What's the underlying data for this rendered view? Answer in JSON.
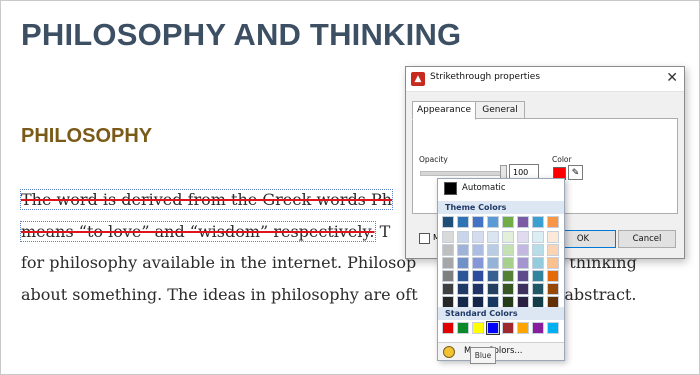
{
  "document": {
    "heading": "PHILOSOPHY AND THINKING",
    "subheading": "PHILOSOPHY",
    "line1": "The word is derived from the Greek words Ph",
    "line2_struck": "means “to love” and “wisdom” respectively.",
    "line2_rest": " T",
    "line3": "for philosophy available in the internet. Philosop",
    "line3_tail": "for thinking",
    "line4": "about something. The ideas in philosophy are oft",
    "line4_tail": "d abstract."
  },
  "dialog": {
    "title": "Strikethrough properties",
    "close_glyph": "✕",
    "tabs": [
      "Appearance",
      "General"
    ],
    "opacity_label": "Opacity",
    "opacity_value": "100",
    "color_label": "Color",
    "color_value": "#ff0000",
    "checkbox_label_visible": "M",
    "ok_label": "OK",
    "cancel_label": "Cancel"
  },
  "color_picker": {
    "automatic_label": "Automatic",
    "theme_colors_label": "Theme Colors",
    "standard_colors_label": "Standard Colors",
    "more_colors_label": "More Colors...",
    "tooltip": "Blue",
    "theme_colors": [
      [
        "#ffffff",
        "#000000",
        "#44546a",
        "#4472c4",
        "#ed7d31",
        "#a5a5a5",
        "#ffc000",
        "#5b9bd5",
        "#70ad47",
        "#7f6084"
      ],
      [
        "#f2f2f2",
        "#7f7f7f",
        "#d6dce5",
        "#d9e2f3",
        "#fbe5d6",
        "#ededed",
        "#fff2cc",
        "#deebf7",
        "#e2f0d9",
        "#e4dfec"
      ],
      [
        "#d9d9d9",
        "#595959",
        "#adb9ca",
        "#b4c7e7",
        "#f8cbad",
        "#dbdbdb",
        "#ffe699",
        "#bdd7ee",
        "#c5e0b4",
        "#ccc0da"
      ],
      [
        "#bfbfbf",
        "#404040",
        "#8497b0",
        "#8faadc",
        "#f4b183",
        "#c9c9c9",
        "#ffd966",
        "#9dc3e6",
        "#a9d18e",
        "#b2a2c7"
      ],
      [
        "#a6a6a6",
        "#262626",
        "#333f50",
        "#2f5597",
        "#c55a11",
        "#7b7b7b",
        "#bf9000",
        "#2e75b6",
        "#548235",
        "#5f497a"
      ],
      [
        "#7f7f7f",
        "#0d0d0d",
        "#222a35",
        "#1f3864",
        "#843c0c",
        "#525252",
        "#7f6000",
        "#1f4e79",
        "#385723",
        "#3f3151"
      ]
    ],
    "theme_colors_shown": [
      [
        "#1f4e79",
        "#2e74b5",
        "#4472c4",
        "#5b9bd5",
        "#70ad47",
        "#7b5aa6",
        "#3c9fd1",
        "#f79646"
      ],
      [
        "#d9d9d9",
        "#c9d5e8",
        "#d6dcf0",
        "#dbe5f1",
        "#e2efd9",
        "#e1dbef",
        "#daeef3",
        "#fde9d9"
      ],
      [
        "#bfbfbf",
        "#9eb3d7",
        "#adbce3",
        "#b8cce4",
        "#c5e0b3",
        "#c3b8df",
        "#b6dde8",
        "#fbd4b4"
      ],
      [
        "#a6a6a6",
        "#7090c8",
        "#8597d6",
        "#95b3d7",
        "#a8d08d",
        "#a595cf",
        "#93cddd",
        "#fac090"
      ],
      [
        "#7f7f7f",
        "#2b5697",
        "#2f4b9e",
        "#366092",
        "#548235",
        "#5f4a8c",
        "#31849b",
        "#e36c09"
      ],
      [
        "#404040",
        "#1f3a66",
        "#203467",
        "#244061",
        "#385723",
        "#3f315e",
        "#215867",
        "#974806"
      ],
      [
        "#262626",
        "#152a4a",
        "#16254a",
        "#17375e",
        "#263c18",
        "#2a2140",
        "#153d48",
        "#632f04"
      ]
    ],
    "standard_colors": [
      "#e00000",
      "#0a8a2a",
      "#ffff00",
      "#0000ff",
      "#a0282a",
      "#ffa500",
      "#8a1d9e",
      "#00b0f0"
    ]
  }
}
